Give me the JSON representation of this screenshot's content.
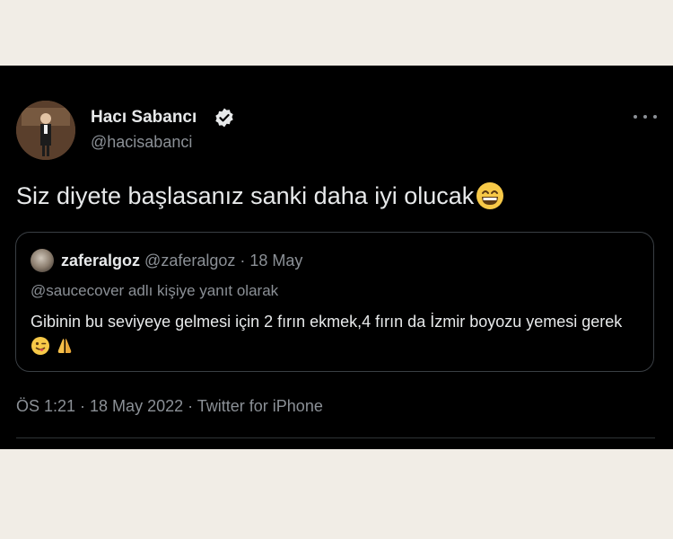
{
  "author": {
    "display_name": "Hacı Sabancı",
    "handle": "@hacisabanci",
    "verified": true
  },
  "tweet": {
    "text": "Siz diyete başlasanız sanki daha iyi olucak",
    "emoji": "grinning-face-with-smiling-eyes"
  },
  "quoted_tweet": {
    "name": "zaferalgoz",
    "meta": "@zaferalgoz · 18 May",
    "reply_context": "@saucecover adlı kişiye yanıt olarak",
    "text": "Gibinin bu seviyeye gelmesi için 2 fırın ekmek,4 fırın da İzmir boyozu yemesi gerek",
    "emojis": [
      "winking-face-with-tongue",
      "folded-hands"
    ]
  },
  "footer": {
    "meta": "ÖS 1:21 · 18 May 2022 · Twitter for iPhone"
  },
  "colors": {
    "background": "#000000",
    "text": "#e7e9ea",
    "muted": "#8b9096",
    "border": "#3a3f44",
    "page": "#f1ede6"
  }
}
